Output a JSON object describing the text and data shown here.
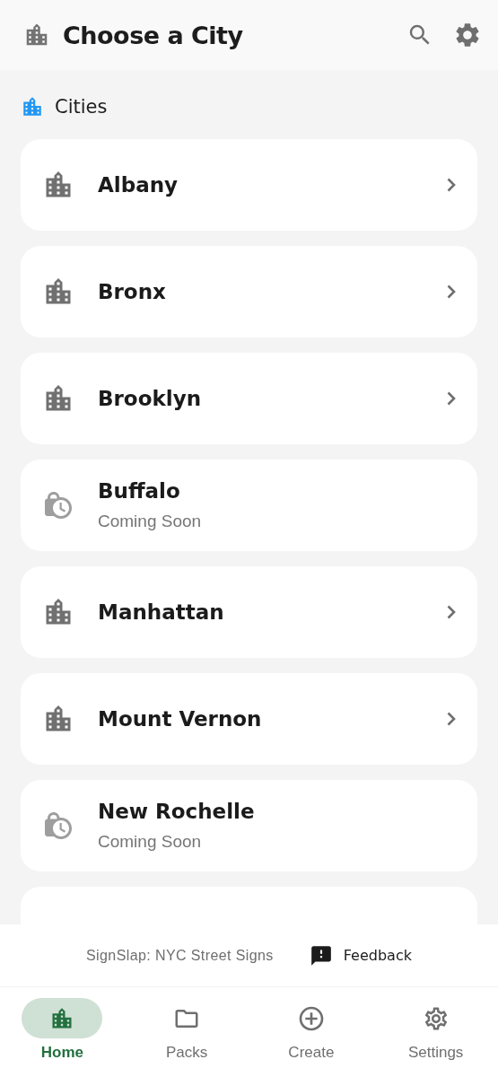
{
  "header": {
    "title": "Choose a City"
  },
  "section": {
    "title": "Cities"
  },
  "cities": [
    {
      "kind": "available",
      "name": "Albany"
    },
    {
      "kind": "available",
      "name": "Bronx"
    },
    {
      "kind": "available",
      "name": "Brooklyn"
    },
    {
      "kind": "coming_soon",
      "name": "Buffalo",
      "note": "Coming Soon"
    },
    {
      "kind": "available",
      "name": "Manhattan"
    },
    {
      "kind": "available",
      "name": "Mount Vernon"
    },
    {
      "kind": "coming_soon",
      "name": "New Rochelle",
      "note": "Coming Soon"
    },
    {
      "kind": "cut_off"
    }
  ],
  "banner": {
    "app_name": "SignSlap: NYC Street Signs",
    "feedback": "Feedback"
  },
  "nav": [
    {
      "kind": "home",
      "label": "Home",
      "selected": true
    },
    {
      "kind": "packs",
      "label": "Packs",
      "selected": false
    },
    {
      "kind": "create",
      "label": "Create",
      "selected": false
    },
    {
      "kind": "settings",
      "label": "Settings",
      "selected": false
    }
  ]
}
